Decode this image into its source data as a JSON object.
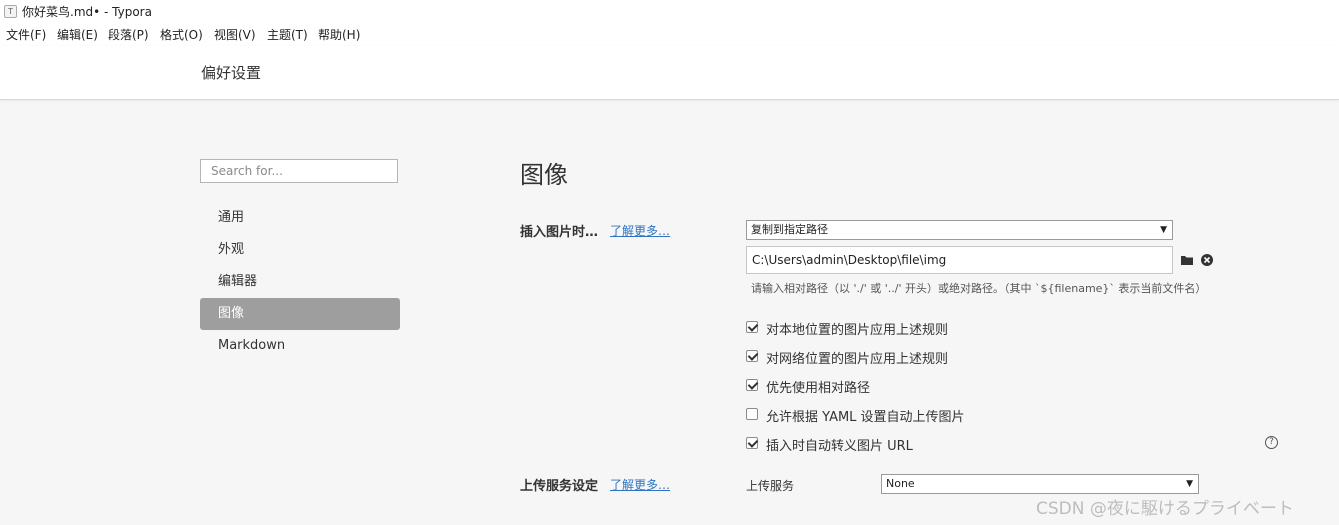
{
  "window": {
    "app_icon": "T",
    "title": "你好菜鸟.md• - Typora"
  },
  "menu": [
    {
      "label": "文件(F)"
    },
    {
      "label": "编辑(E)"
    },
    {
      "label": "段落(P)"
    },
    {
      "label": "格式(O)"
    },
    {
      "label": "视图(V)"
    },
    {
      "label": "主题(T)"
    },
    {
      "label": "帮助(H)"
    }
  ],
  "preferences": {
    "title": "偏好设置",
    "search": {
      "placeholder": "Search for...",
      "value": ""
    },
    "nav": [
      {
        "label": "通用",
        "active": false
      },
      {
        "label": "外观",
        "active": false
      },
      {
        "label": "编辑器",
        "active": false
      },
      {
        "label": "图像",
        "active": true
      },
      {
        "label": "Markdown",
        "active": false
      }
    ]
  },
  "image_section": {
    "title": "图像",
    "insert": {
      "label": "插入图片时…",
      "learn_more": "了解更多…",
      "action_select": "复制到指定路径",
      "path_value": "C:\\Users\\admin\\Desktop\\file\\img",
      "hint": "请输入相对路径（以 './' 或 '../' 开头）或绝对路径。（其中 `${filename}` 表示当前文件名）"
    },
    "options": [
      {
        "label": "对本地位置的图片应用上述规则",
        "checked": true
      },
      {
        "label": "对网络位置的图片应用上述规则",
        "checked": true
      },
      {
        "label": "优先使用相对路径",
        "checked": true
      },
      {
        "label": "允许根据 YAML 设置自动上传图片",
        "checked": false
      },
      {
        "label": "插入时自动转义图片 URL",
        "checked": true
      }
    ],
    "help_icon": "?",
    "upload": {
      "label": "上传服务设定",
      "learn_more": "了解更多…",
      "service_label": "上传服务",
      "service_value": "None"
    }
  },
  "icons": {
    "folder": "folder-icon",
    "clear": "clear-icon",
    "dropdown": "chevron-down-icon",
    "help": "help-icon"
  },
  "watermark": "CSDN @夜に駆けるプライベート"
}
